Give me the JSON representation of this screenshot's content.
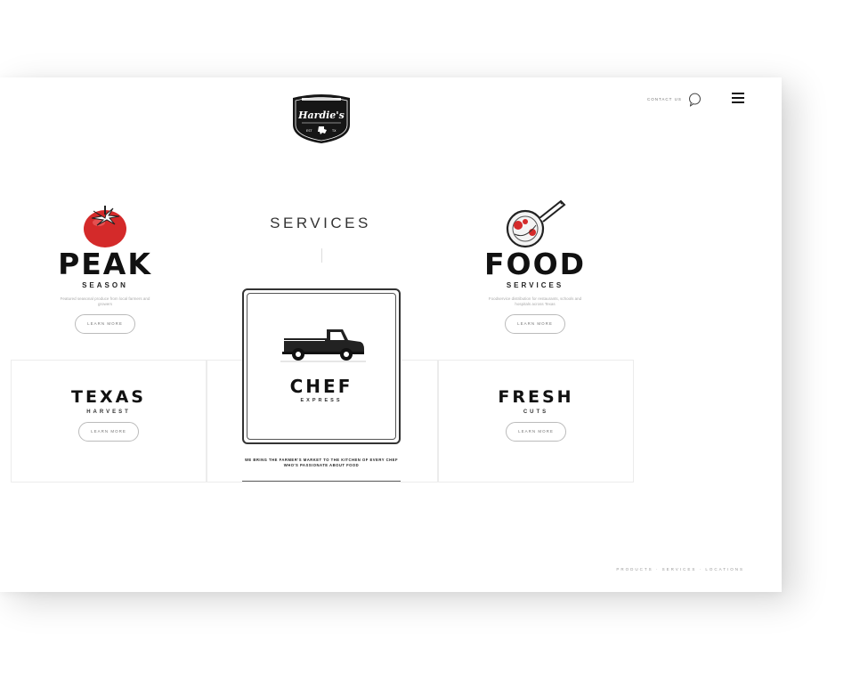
{
  "header": {
    "logo_text": "Hardie's",
    "contact_label": "CONTACT US",
    "icons": {
      "chat": "chat-bubble-icon",
      "menu": "hamburger-menu-icon"
    }
  },
  "services": {
    "title": "SERVICES"
  },
  "peak": {
    "title": "PEAK",
    "subtitle": "SEASON",
    "description": "Featured seasonal produce from local farmers and growers",
    "button": "LEARN MORE",
    "icon": "tomato-icon"
  },
  "food": {
    "title": "FOOD",
    "subtitle": "SERVICES",
    "description": "Foodservice distribution for restaurants, schools and hospitals across Texas",
    "button": "LEARN MORE",
    "icon": "skillet-icon"
  },
  "texas": {
    "title": "TEXAS",
    "subtitle": "HARVEST",
    "button": "LEARN MORE"
  },
  "chef": {
    "title": "CHEF",
    "subtitle": "EXPRESS",
    "description": "WE BRING THE FARMER'S MARKET TO THE KITCHEN OF EVERY CHEF WHO'S PASSIONATE ABOUT FOOD",
    "icon": "pickup-truck-icon"
  },
  "fresh": {
    "title": "FRESH",
    "subtitle": "CUTS",
    "button": "LEARN MORE"
  },
  "footer": {
    "text": "PRODUCTS · SERVICES · LOCATIONS"
  },
  "colors": {
    "accent_red": "#d42a2a",
    "ink": "#111111"
  }
}
